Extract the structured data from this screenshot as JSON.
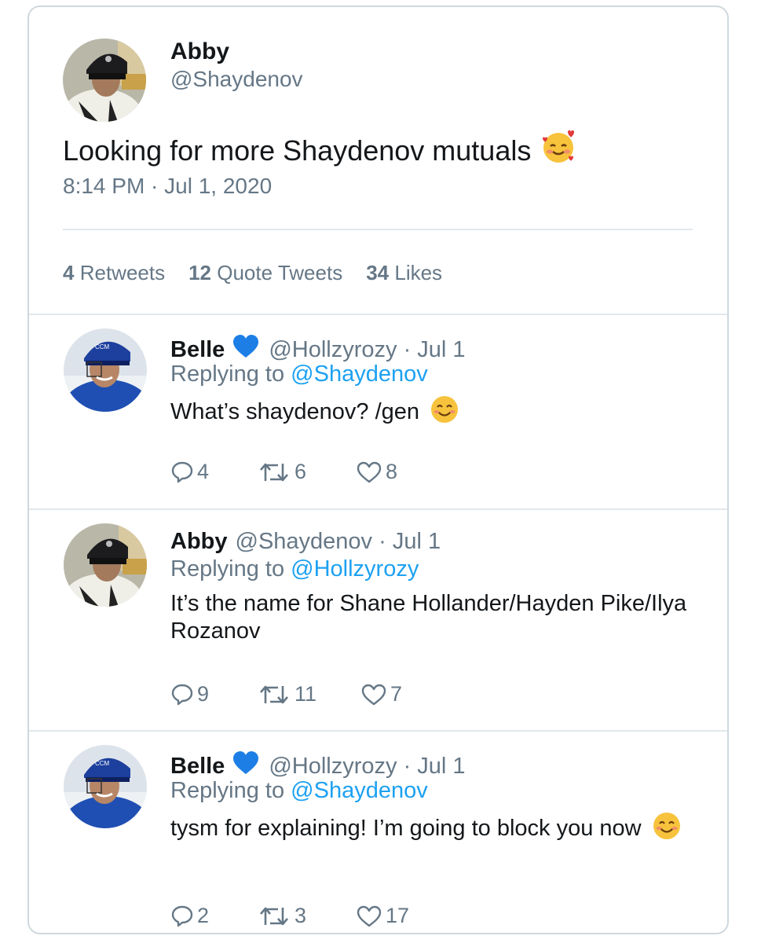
{
  "main_tweet": {
    "name": "Abby",
    "handle": "@Shaydenov",
    "text": "Looking for more Shaydenov mutuals",
    "emoji_icon": "smiling-face-with-hearts-icon",
    "timestamp": "8:14 PM · Jul 1, 2020",
    "stats": {
      "retweets_count": "4",
      "retweets_label": "Retweets",
      "quotes_count": "12",
      "quotes_label": "Quote Tweets",
      "likes_count": "34",
      "likes_label": "Likes"
    }
  },
  "replies": [
    {
      "name": "Belle",
      "badge_icon": "blue-heart-icon",
      "handle": "@Hollzyrozy",
      "date": "· Jul 1",
      "replying_label": "Replying to",
      "replying_to": "@Shaydenov",
      "text": "What’s shaydenov? /gen",
      "emoji_icon": "smiling-face-icon",
      "replies": "4",
      "retweets": "6",
      "likes": "8"
    },
    {
      "name": "Abby",
      "handle": "@Shaydenov",
      "date": "· Jul 1",
      "replying_label": "Replying to",
      "replying_to": "@Hollzyrozy",
      "text": "It’s the name for Shane Hollander/Hayden Pike/Ilya Rozanov",
      "replies": "9",
      "retweets": "11",
      "likes": "7"
    },
    {
      "name": "Belle",
      "badge_icon": "blue-heart-icon",
      "handle": "@Hollzyrozy",
      "date": "· Jul 1",
      "replying_label": "Replying to",
      "replying_to": "@Shaydenov",
      "text": "tysm for explaining! I’m going to block you now",
      "emoji_icon": "smiling-face-icon",
      "replies": "2",
      "retweets": "3",
      "likes": "17"
    }
  ],
  "colors": {
    "text": "#14171a",
    "muted": "#657786",
    "link": "#1da1f2",
    "divider": "#e1e8ed",
    "heart_badge": "#1d7fe6"
  }
}
